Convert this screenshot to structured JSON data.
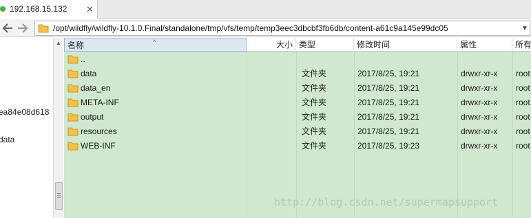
{
  "tab": {
    "title": "192.168.15.132",
    "close": "✕"
  },
  "addressbar": {
    "path": "/opt/wildfly/wildfly-10.1.0.Final/standalone/tmp/vfs/temp/temp3eec3dbcbf3fb6db/content-a61c9a145e99dc05"
  },
  "tree": {
    "items": [
      "ea84e08d618",
      "data"
    ]
  },
  "columns": [
    "名称",
    "大小",
    "类型",
    "修改时间",
    "属性",
    "所有"
  ],
  "files": [
    {
      "name": "..",
      "size": "",
      "type": "",
      "modified": "",
      "perms": "",
      "owner": ""
    },
    {
      "name": "data",
      "size": "",
      "type": "文件夹",
      "modified": "2017/8/25, 19:21",
      "perms": "drwxr-xr-x",
      "owner": "root"
    },
    {
      "name": "data_en",
      "size": "",
      "type": "文件夹",
      "modified": "2017/8/25, 19:21",
      "perms": "drwxr-xr-x",
      "owner": "root"
    },
    {
      "name": "META-INF",
      "size": "",
      "type": "文件夹",
      "modified": "2017/8/25, 19:21",
      "perms": "drwxr-xr-x",
      "owner": "root"
    },
    {
      "name": "output",
      "size": "",
      "type": "文件夹",
      "modified": "2017/8/25, 19:21",
      "perms": "drwxr-xr-x",
      "owner": "root"
    },
    {
      "name": "resources",
      "size": "",
      "type": "文件夹",
      "modified": "2017/8/25, 19:21",
      "perms": "drwxr-xr-x",
      "owner": "root"
    },
    {
      "name": "WEB-INF",
      "size": "",
      "type": "文件夹",
      "modified": "2017/8/25, 19:23",
      "perms": "drwxr-xr-x",
      "owner": "root"
    }
  ],
  "watermark": "http://blog.csdn.net/supermapsupport",
  "colors": {
    "list_bg": "#cfe8cf",
    "status_dot": "#3cb93c",
    "folder": "#f2c04b"
  }
}
